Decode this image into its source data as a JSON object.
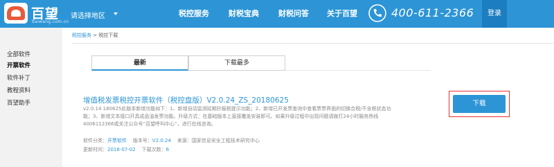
{
  "header": {
    "logo_text": "百望",
    "logo_sub": "baiwang.com.cn",
    "region": "请选择地区",
    "nav": [
      "税控服务",
      "财税宝典",
      "财税问答",
      "关于百望"
    ],
    "phone": "400-611-2366",
    "login": "登录"
  },
  "sidebar": {
    "items": [
      "全部软件",
      "开票软件",
      "软件补丁",
      "教程资料",
      "百望助手"
    ],
    "active_index": 1
  },
  "breadcrumb": {
    "root": "税控服务",
    "separator": ">",
    "current": "税控下载"
  },
  "tabs": [
    "最新",
    "下载最多"
  ],
  "software": {
    "title": "增值税发票税控开票软件（税控盘版）V2.0.24_ZS_20180625",
    "description": "v2.0.14 180625此版本新增功能如下：1、新增自动监测延期抄报税提示功能；2、新增已开发票查询中查看票票界面的切换合税/不含税状态功能；3、新增文本接口开具成品油发票功能。升级方式：在基础版本上直接覆盖安装即可。如果升级过程中出现问题请拨打24小时服务热线4006112366或关注公众号“百望呼叫中心”，进行在线咨询。",
    "category_label": "软件分类：",
    "category": "开票软件",
    "version_label": "版本号：",
    "version": "V2.0.24",
    "source_label": "来源：",
    "source": "国家信息安全工程技术研究中心",
    "date_label": "更新时间：",
    "date": "2018-07-02",
    "downloads_label": "下载次数：",
    "downloads": "6",
    "download_button": "下载"
  },
  "colors": {
    "brand": "#2d95d6",
    "highlight": "#e53030"
  }
}
